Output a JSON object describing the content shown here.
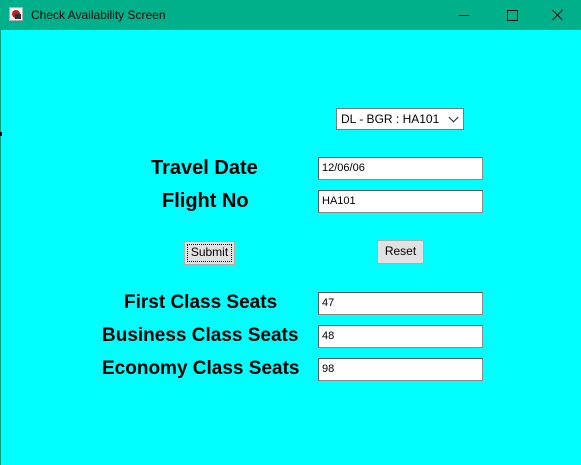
{
  "window": {
    "title": "Check Availability Screen",
    "app_icon": "java-cup-icon",
    "controls": [
      "minimize-icon",
      "maximize-icon",
      "close-icon"
    ],
    "background_color": "#00ffff",
    "titlebar_color": "#00b08a"
  },
  "route_select": {
    "selected": "DL - BGR : HA101"
  },
  "form": {
    "travel_date_label": "Travel Date",
    "travel_date_value": "12/06/06",
    "flight_no_label": "Flight No",
    "flight_no_value": "HA101"
  },
  "buttons": {
    "submit_label": "Submit",
    "reset_label": "Reset"
  },
  "seats": {
    "first_label": "First Class Seats",
    "first_value": "47",
    "business_label": "Business Class Seats",
    "business_value": "48",
    "economy_label": "Economy Class Seats",
    "economy_value": "98"
  }
}
